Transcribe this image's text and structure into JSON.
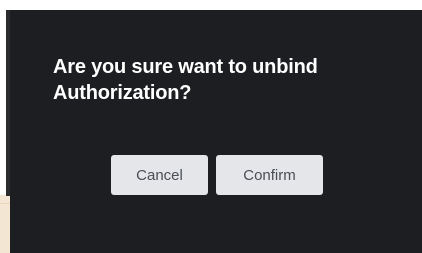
{
  "dialog": {
    "message": "Are you sure want to unbind Authorization?",
    "cancel_label": "Cancel",
    "confirm_label": "Confirm"
  },
  "colors": {
    "dialog_background": "#1c1e21",
    "button_background": "#e4e6e9",
    "button_text": "#4a4e54",
    "message_text": "#ffffff"
  }
}
